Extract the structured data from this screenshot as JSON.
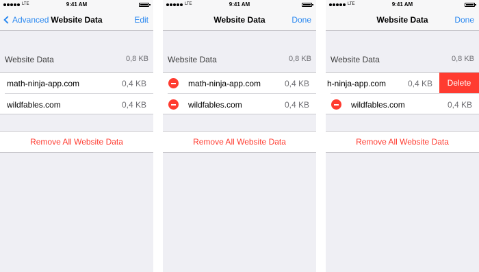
{
  "status": {
    "carrier": "LTE",
    "time": "9:41 AM"
  },
  "screens": [
    {
      "back_label": "Advanced",
      "title": "Website Data",
      "right_button": "Edit",
      "section": {
        "label": "Website Data",
        "size": "0,8 KB"
      },
      "rows": [
        {
          "name": "math-ninja-app.com",
          "size": "0,4 KB"
        },
        {
          "name": "wildfables.com",
          "size": "0,4 KB"
        }
      ],
      "remove_all": "Remove All Website Data"
    },
    {
      "title": "Website Data",
      "right_button": "Done",
      "section": {
        "label": "Website Data",
        "size": "0,8 KB"
      },
      "rows": [
        {
          "name": "math-ninja-app.com",
          "size": "0,4 KB"
        },
        {
          "name": "wildfables.com",
          "size": "0,4 KB"
        }
      ],
      "remove_all": "Remove All Website Data"
    },
    {
      "title": "Website Data",
      "right_button": "Done",
      "section": {
        "label": "Website Data",
        "size": "0,8 KB"
      },
      "rows": [
        {
          "name": "h-ninja-app.com",
          "size": "0,4 KB",
          "delete_label": "Delete"
        },
        {
          "name": "wildfables.com",
          "size": "0,4 KB"
        }
      ],
      "remove_all": "Remove All Website Data"
    }
  ]
}
